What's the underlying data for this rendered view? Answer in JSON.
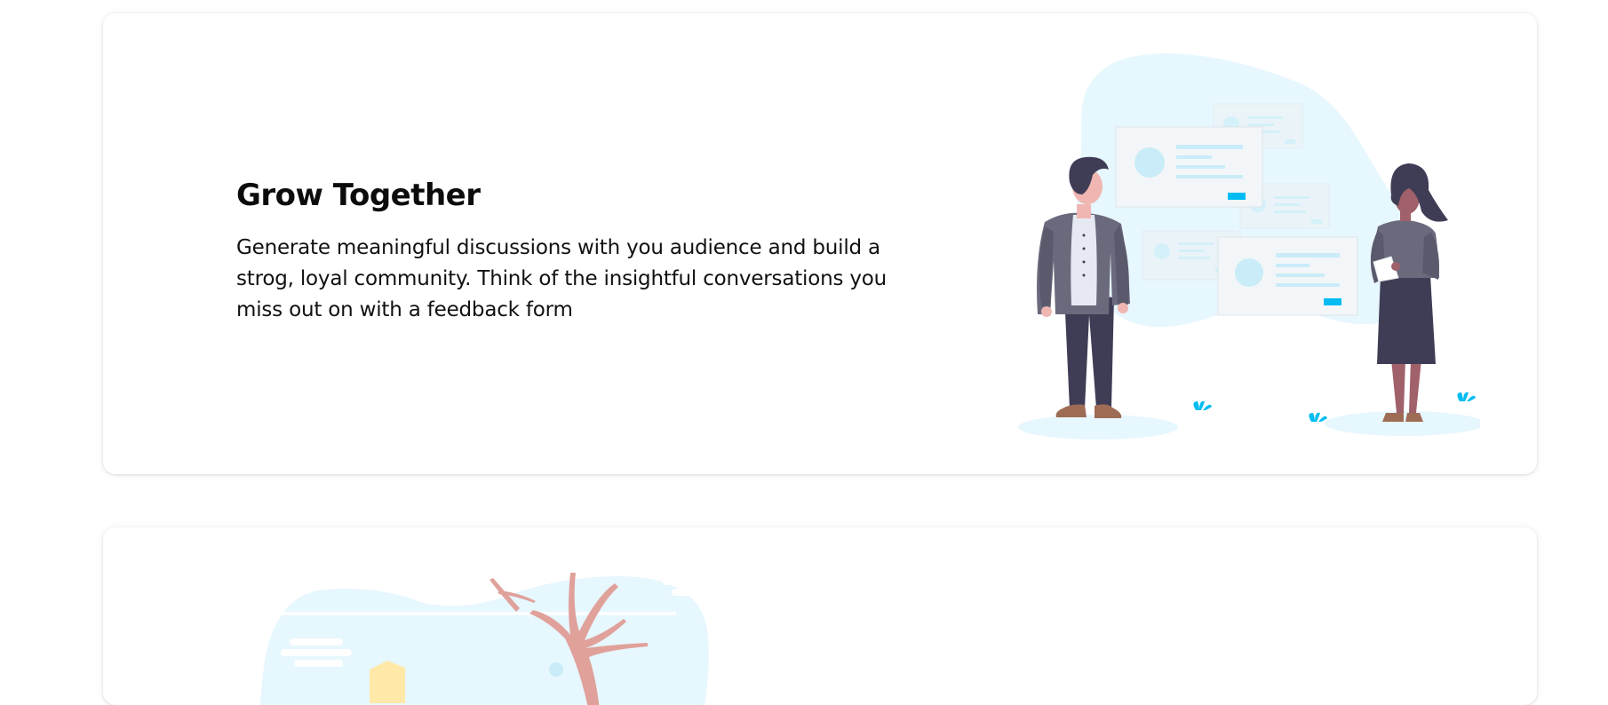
{
  "feature_1": {
    "title": "Grow Together",
    "description": "Generate meaningful discussions with you audience and build a strog, loyal community. Think of the insightful conversations you miss out on with a feedback form"
  },
  "colors": {
    "accent": "#00bcf2",
    "blob": "#e6f7fd",
    "card_panel": "#f3f6f8",
    "text": "#0c0c0c",
    "tree": "#e0a19b",
    "person_dark": "#3f3d56",
    "skin": "#f0b6b1",
    "skin_dark": "#a0616a"
  },
  "illustrations": {
    "feature_1": "people-discussion-illustration",
    "feature_2": "tree-landscape-illustration"
  }
}
